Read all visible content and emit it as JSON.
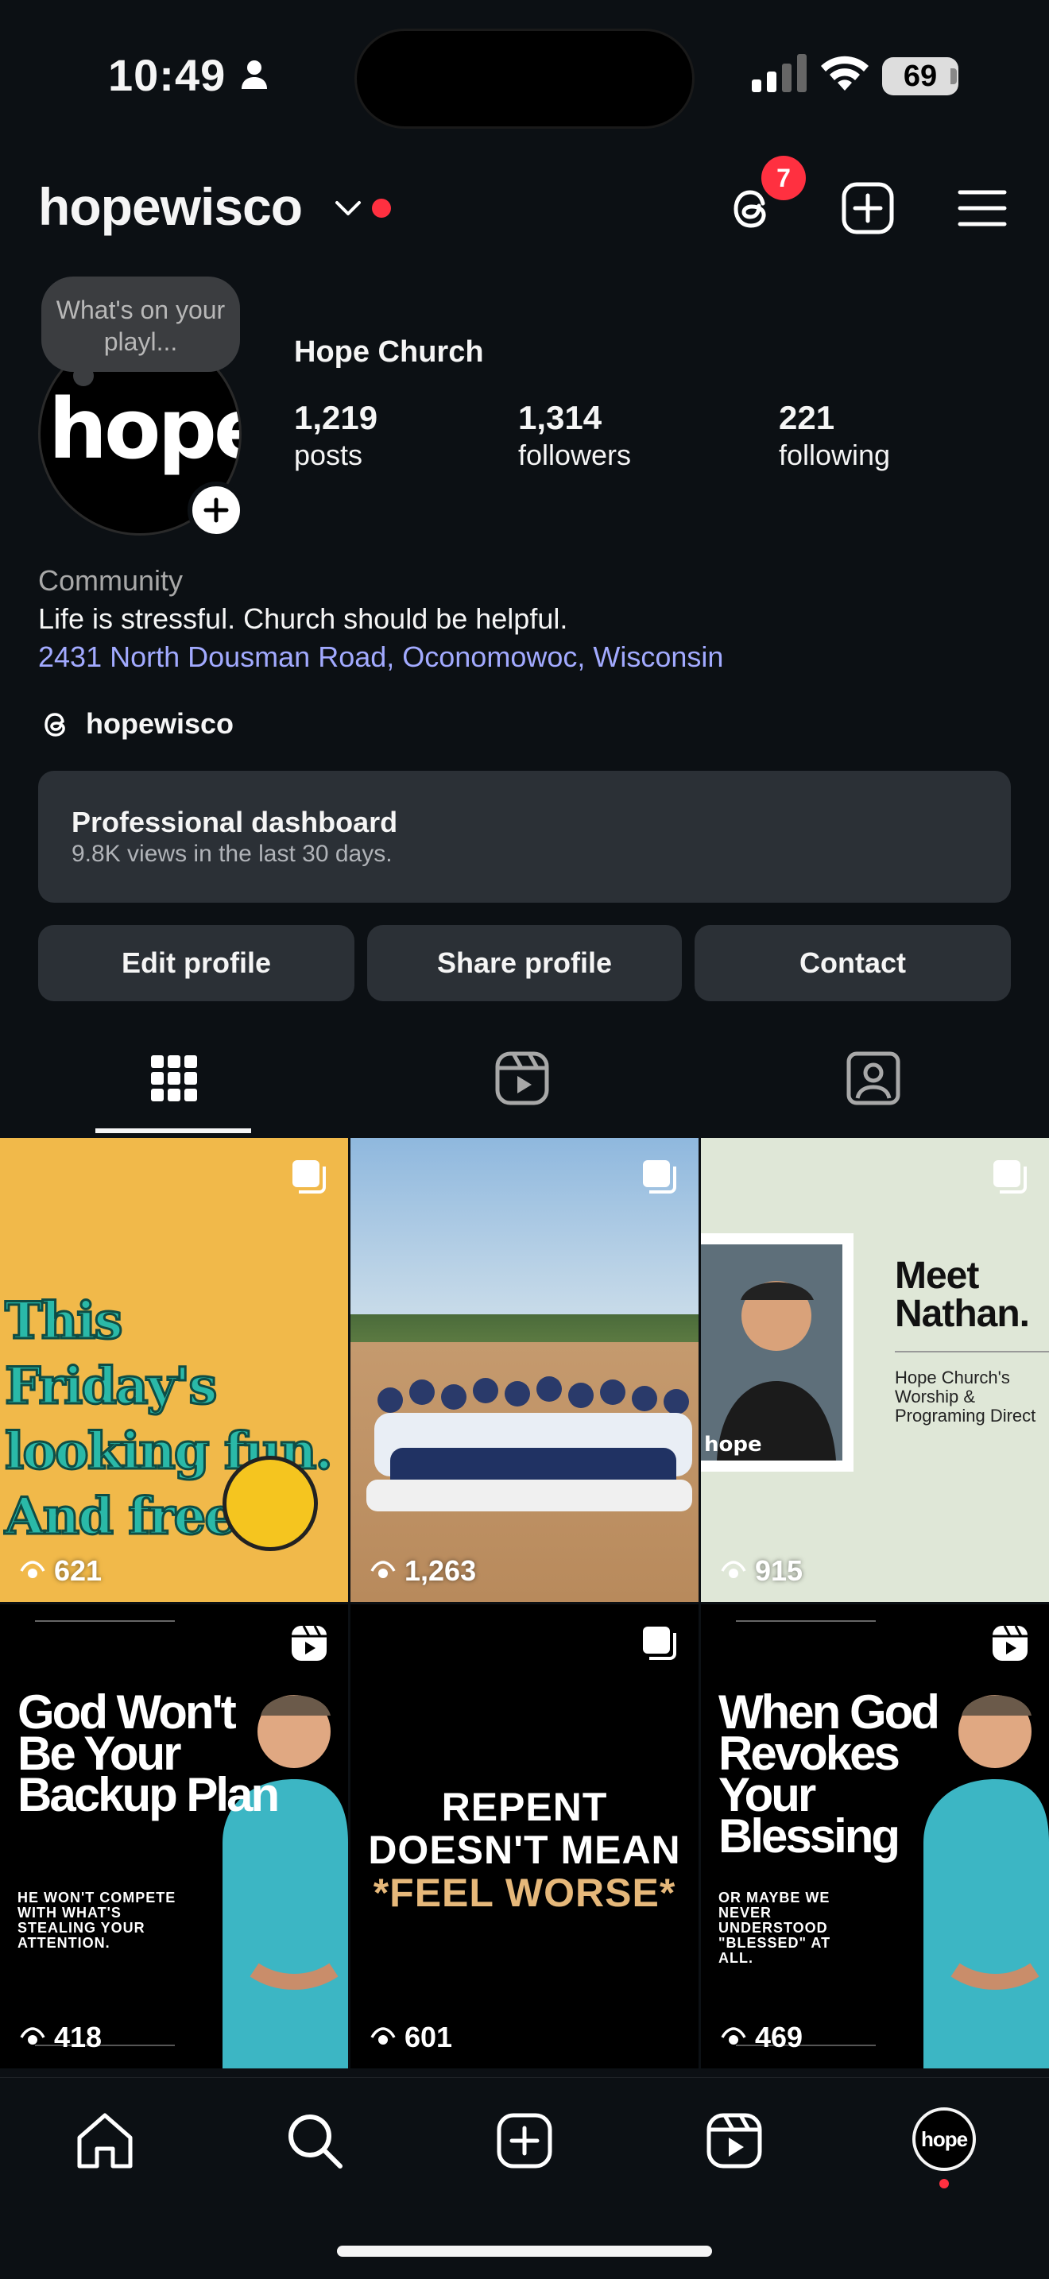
{
  "status_bar": {
    "time": "10:49",
    "battery": "69"
  },
  "header": {
    "username": "hopewisco",
    "threads_badge": "7"
  },
  "profile": {
    "note": "What's on your playl...",
    "avatar_text": "hope",
    "display_name": "Hope Church",
    "stats": [
      {
        "value": "1,219",
        "label": "posts"
      },
      {
        "value": "1,314",
        "label": "followers"
      },
      {
        "value": "221",
        "label": "following"
      }
    ],
    "category": "Community",
    "bio": "Life is stressful. Church should be helpful.",
    "address": "2431 North Dousman Road, Oconomowoc, Wisconsin",
    "threads_handle": "hopewisco"
  },
  "dashboard": {
    "title": "Professional dashboard",
    "subtitle": "9.8K views in the last 30 days."
  },
  "buttons": {
    "edit": "Edit profile",
    "share": "Share profile",
    "contact": "Contact"
  },
  "posts": [
    {
      "views": "621",
      "text": "This Friday's looking fun. And free."
    },
    {
      "views": "1,263"
    },
    {
      "views": "915",
      "title": "Meet Nathan.",
      "subtitle": "Hope Church's Worship & Programing Direct",
      "photo_text": "hope"
    },
    {
      "views": "418",
      "title": "God Won't Be Your Backup Plan",
      "subtitle": "HE WON'T COMPETE WITH WHAT'S STEALING YOUR ATTENTION."
    },
    {
      "views": "601",
      "line1": "REPENT",
      "line2": "DOESN'T MEAN",
      "line3": "*FEEL WORSE*"
    },
    {
      "views": "469",
      "title": "When God Revokes Your Blessing",
      "subtitle": "OR MAYBE WE NEVER UNDERSTOOD \"BLESSED\" AT ALL."
    }
  ],
  "nav": {
    "avatar_text": "hope"
  },
  "colors": {
    "accent_link": "#a2aaff",
    "notification": "#ff3040",
    "background": "#0c1014"
  }
}
